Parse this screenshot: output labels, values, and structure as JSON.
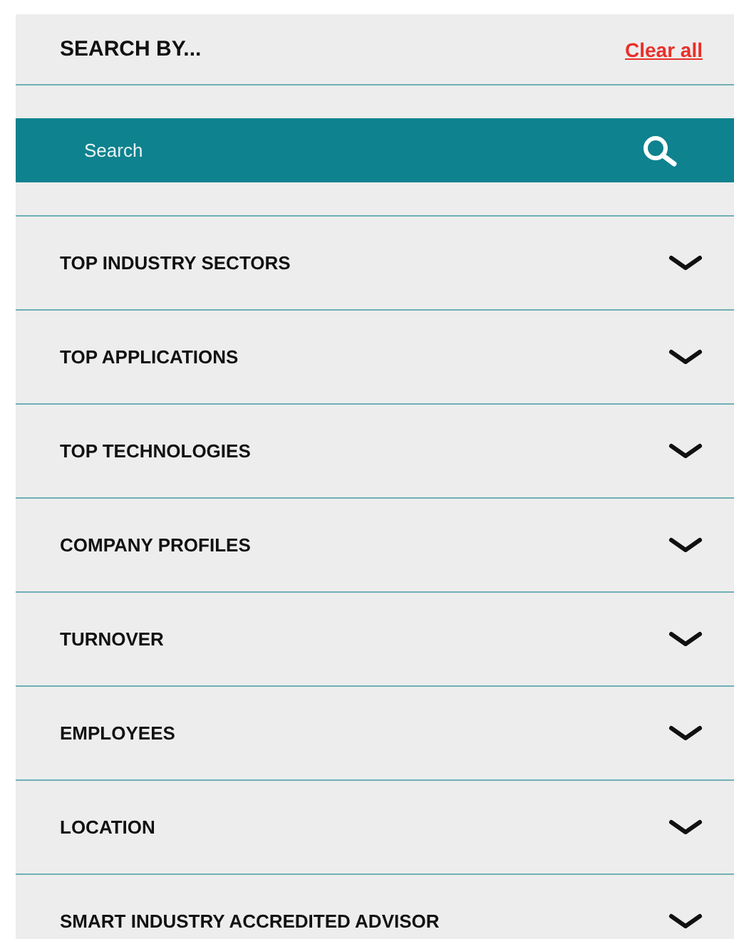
{
  "header": {
    "title": "SEARCH BY...",
    "clear_link": "Clear all"
  },
  "search": {
    "placeholder": "Search"
  },
  "filters": [
    {
      "label": "TOP INDUSTRY SECTORS",
      "expanded": false
    },
    {
      "label": "TOP APPLICATIONS",
      "expanded": false
    },
    {
      "label": "TOP TECHNOLOGIES",
      "expanded": false
    },
    {
      "label": "COMPANY PROFILES",
      "expanded": false
    },
    {
      "label": "TURNOVER",
      "expanded": false
    },
    {
      "label": "EMPLOYEES",
      "expanded": false
    },
    {
      "label": "LOCATION",
      "expanded": false
    },
    {
      "label": "SMART INDUSTRY ACCREDITED ADVISOR",
      "expanded": false
    }
  ]
}
